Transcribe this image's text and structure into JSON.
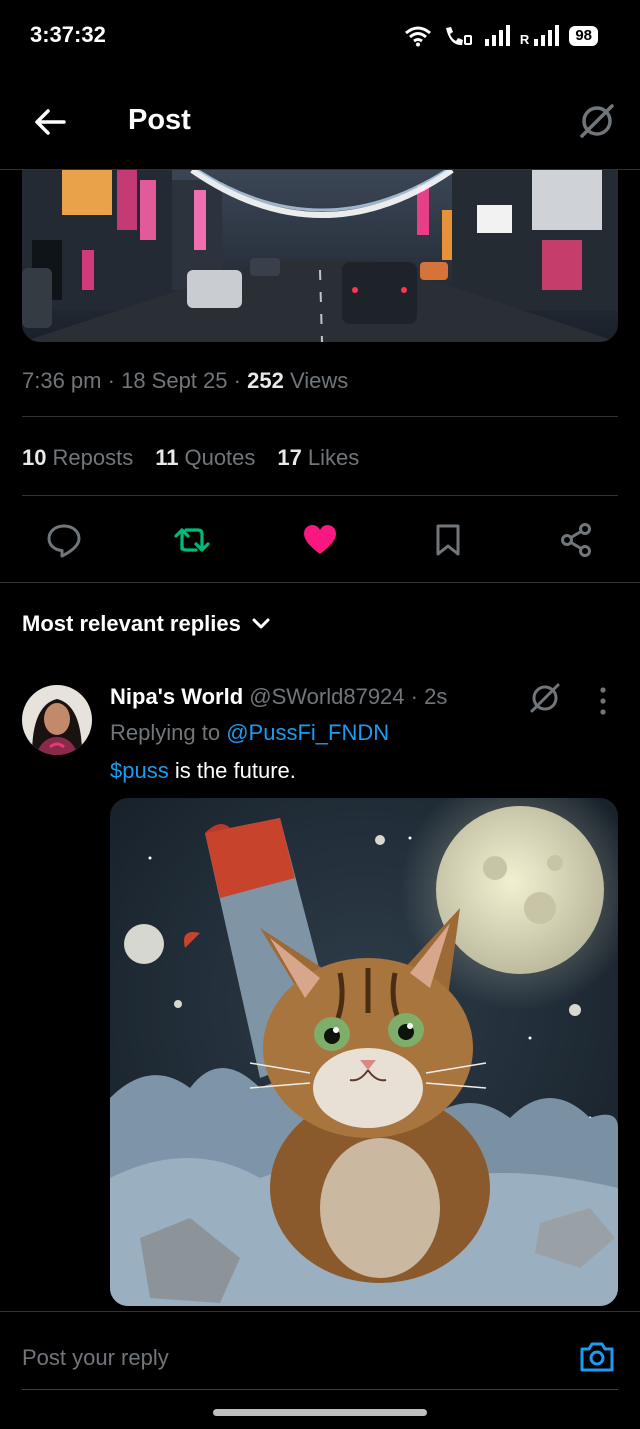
{
  "status_bar": {
    "time": "3:37:32",
    "roaming_label": "R",
    "battery": "98"
  },
  "header": {
    "title": "Post"
  },
  "tweet": {
    "image_alt": "Night city street with neon signs",
    "time": "7:36 pm",
    "date": "18 Sept 25",
    "views_count": "252",
    "views_label": "Views",
    "reposts_count": "10",
    "reposts_label": "Reposts",
    "quotes_count": "11",
    "quotes_label": "Quotes",
    "likes_count": "17",
    "likes_label": "Likes",
    "liked": true
  },
  "replies": {
    "sort_label": "Most relevant replies",
    "items": [
      {
        "name": "Nipa's World",
        "handle": "@SWorld87924",
        "age": "2s",
        "replying_to_label": "Replying to",
        "replying_to_handle": "@PussFi_FNDN",
        "cashtag": "$puss",
        "text": " is the future.",
        "image_alt": "Kitten in front of a rocket and the moon"
      }
    ]
  },
  "composer": {
    "placeholder": "Post your reply"
  },
  "colors": {
    "background": "#000000",
    "accent_blue": "#1d9bf0",
    "repost_green": "#00ba7c",
    "like_pink": "#f91880",
    "muted": "#71767b"
  },
  "icons": {
    "back": "arrow-left-icon",
    "grok": "grok-icon",
    "reply": "speech-bubble-icon",
    "repost": "repost-icon",
    "like": "heart-icon",
    "bookmark": "bookmark-icon",
    "share": "share-icon",
    "more": "more-vertical-icon",
    "camera": "camera-icon"
  }
}
